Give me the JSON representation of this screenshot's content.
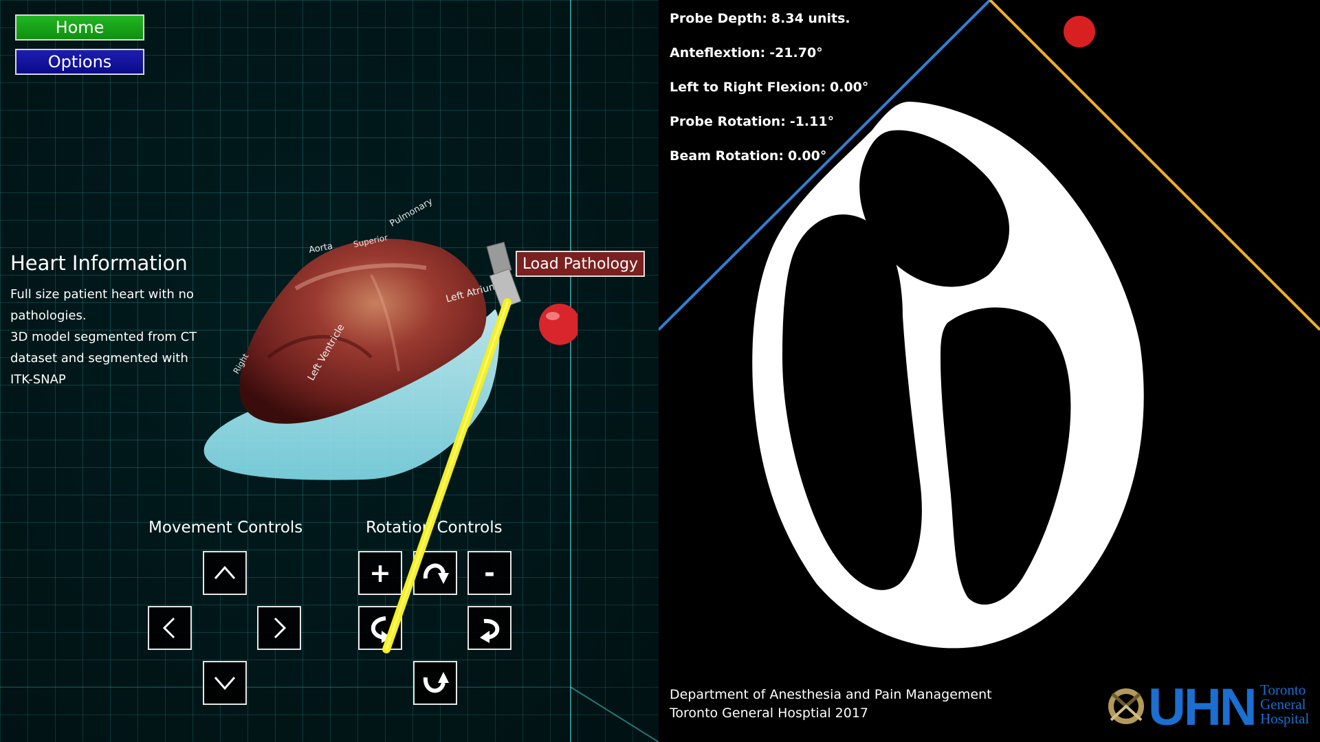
{
  "menu": {
    "home_label": "Home",
    "options_label": "Options"
  },
  "heart_info": {
    "title": "Heart Information",
    "lines": [
      "Full size patient heart with no",
      "pathologies.",
      "3D model segmented from CT",
      "dataset and segmented with",
      "ITK-SNAP"
    ]
  },
  "model_labels": {
    "aorta": "Aorta",
    "pulmonary": "Pulmonary",
    "superior": "Superior",
    "left_atrium": "Left Atrium",
    "right": "Right",
    "left_ventricle": "Left Ventricle"
  },
  "load_pathology_label": "Load Pathology",
  "movement_controls": {
    "title": "Movement Controls",
    "up_icon": "chevron-up-icon",
    "down_icon": "chevron-down-icon",
    "left_icon": "chevron-left-icon",
    "right_icon": "chevron-right-icon"
  },
  "rotation_controls": {
    "title": "Rotation Controls",
    "plus_label": "+",
    "minus_label": "-"
  },
  "readouts": [
    {
      "label": "Probe Depth:",
      "value": "8.34 units."
    },
    {
      "label": "Anteflextion:",
      "value": "-21.70°"
    },
    {
      "label": "Left to Right Flexion:",
      "value": "0.00°"
    },
    {
      "label": "Probe Rotation:",
      "value": "-1.11°"
    },
    {
      "label": "Beam Rotation:",
      "value": "0.00°"
    }
  ],
  "footer": {
    "line1": "Department of Anesthesia and Pain Management",
    "line2": "Toronto General Hosptial 2017"
  },
  "logo": {
    "acronym": "UHN",
    "line1": "Toronto",
    "line2": "General",
    "line3": "Hospital"
  },
  "colors": {
    "home_button": "#1aa61a",
    "options_button": "#10109a",
    "load_pathology": "#7a2020",
    "sector_left_edge": "#2f7fd6",
    "sector_right_edge": "#f2b21c",
    "marker": "#d92020",
    "probe": "#f5f020",
    "logo_blue": "#1a6fd1"
  }
}
